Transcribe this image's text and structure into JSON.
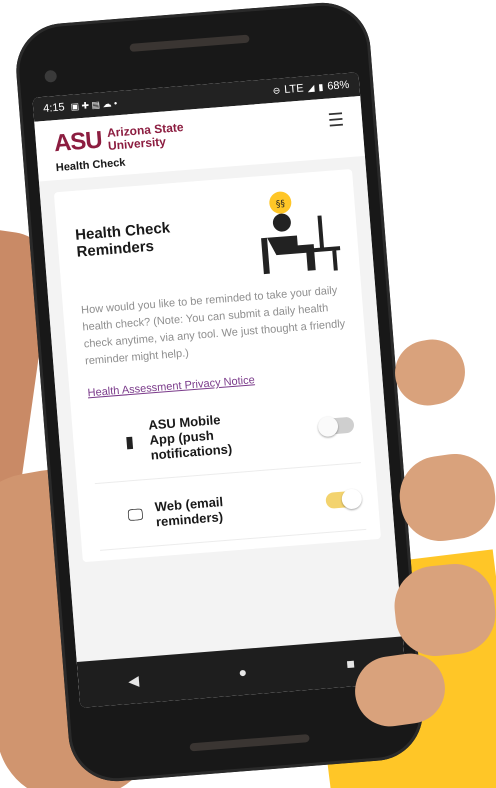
{
  "statusbar": {
    "time": "4:15",
    "left_icons": [
      "📧",
      "✉",
      "◻",
      "☁",
      "•"
    ],
    "carrier": "LTE",
    "battery": "68%"
  },
  "appbar": {
    "logo": "ASU",
    "university_line1": "Arizona State",
    "university_line2": "University",
    "title": "Health Check",
    "menu_icon": "☰"
  },
  "card": {
    "title": "Health Check Reminders",
    "description": "How would you like to be reminded to take your daily health check? (Note: You can submit a daily health check anytime, via any tool. We just thought a friendly reminder might help.)",
    "privacy_link": "Health Assessment Privacy Notice"
  },
  "options": [
    {
      "label": "ASU Mobile App (push notifications)",
      "icon": "📱",
      "enabled": false
    },
    {
      "label": "Web (email reminders)",
      "icon": "🖥",
      "enabled": true
    }
  ],
  "navbar": {
    "back": "◀",
    "home": "●",
    "recents": "■"
  },
  "colors": {
    "asu_maroon": "#8c1d40",
    "asu_gold": "#ffc627",
    "link": "#7a3a8a",
    "toggle_on": "#f3d36e"
  }
}
